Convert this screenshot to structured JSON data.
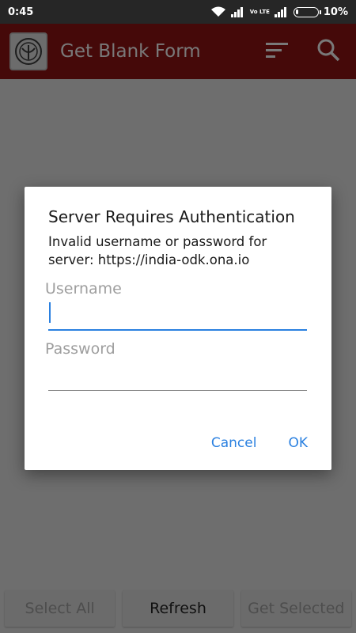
{
  "status_bar": {
    "time": "0:45",
    "network_type": "Vo LTE",
    "battery_percent": "10%",
    "battery_level": 0.1,
    "icons": [
      "wifi-icon",
      "signal-icon",
      "volte-icon",
      "signal-icon",
      "battery-icon"
    ]
  },
  "app_bar": {
    "title": "Get Blank Form",
    "logo_icon": "uttar-pradesh-emblem-icon",
    "sort_icon": "sort-icon",
    "search_icon": "search-icon",
    "color": "#8a1212"
  },
  "bottom_bar": {
    "select_all_label": "Select All",
    "refresh_label": "Refresh",
    "get_selected_label": "Get Selected"
  },
  "dialog": {
    "title": "Server Requires Authentication",
    "message": "Invalid username or password for server: https://india-odk.ona.io",
    "username_label": "Username",
    "username_value": "",
    "password_label": "Password",
    "password_value": "",
    "cancel_label": "Cancel",
    "ok_label": "OK",
    "accent_color": "#2a80e0"
  }
}
